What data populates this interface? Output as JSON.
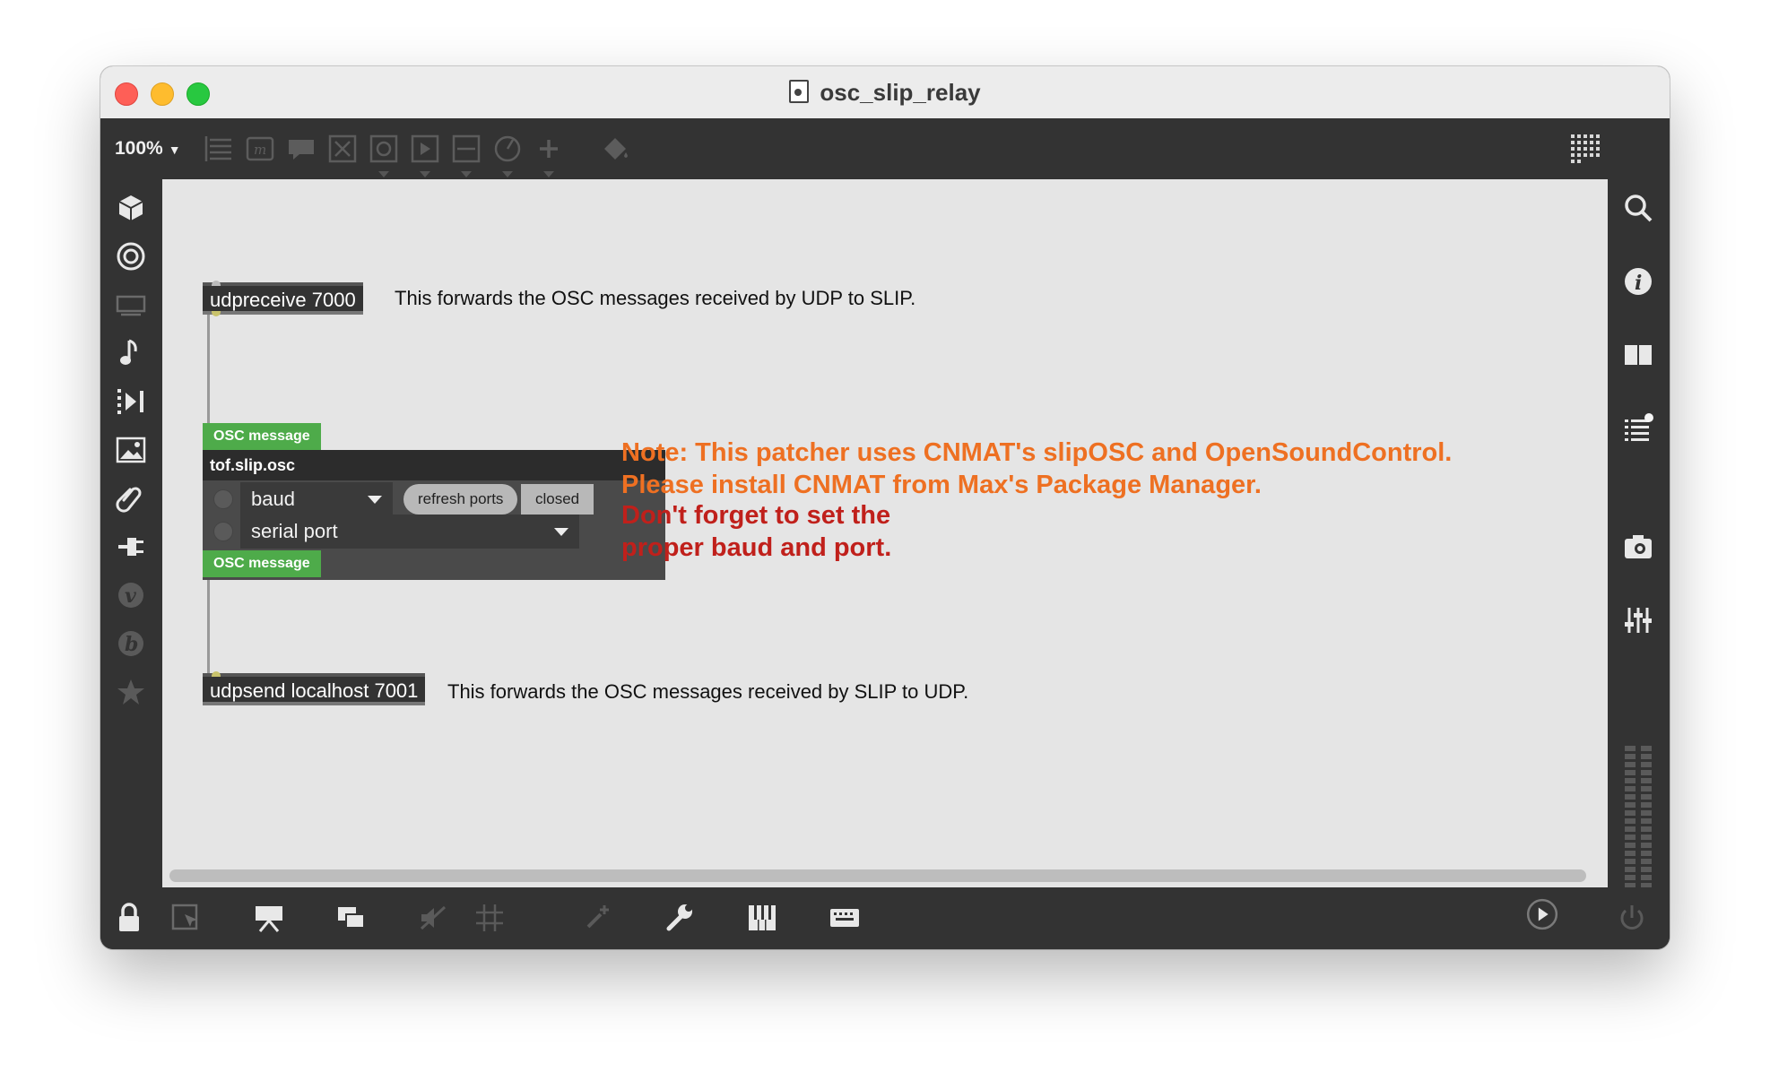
{
  "window": {
    "title": "osc_slip_relay"
  },
  "toolbar": {
    "zoom": "100%",
    "icons": [
      "presentation-icon",
      "message-icon",
      "comment-icon",
      "close-box-icon",
      "button-icon",
      "play-icon",
      "slider-icon",
      "dial-icon",
      "plus-icon",
      "paint-bucket-icon",
      "grid-icon"
    ]
  },
  "left_sidebar": {
    "icons": [
      "cube-icon",
      "target-icon",
      "monitor-icon",
      "music-note-icon",
      "media-icon",
      "image-icon",
      "paperclip-icon",
      "plug-icon",
      "v-icon",
      "b-icon",
      "star-icon"
    ]
  },
  "right_sidebar": {
    "icons": [
      "search-icon",
      "info-icon",
      "book-icon",
      "list-icon",
      "camera-icon",
      "mixer-icon"
    ]
  },
  "patch": {
    "udpreceive": {
      "text": "udpreceive 7000"
    },
    "comment_top": {
      "text": "This forwards the OSC messages received by UDP to SLIP."
    },
    "osc_in": {
      "text": "OSC message"
    },
    "bpatcher": {
      "title": "tof.slip.osc",
      "baud_menu": "baud",
      "refresh_button": "refresh ports",
      "status_toggle": "closed",
      "port_menu": "serial port"
    },
    "osc_out": {
      "text": "OSC message"
    },
    "note_orange_line1": "Note: This patcher uses CNMAT's slipOSC and OpenSoundControl.",
    "note_orange_line2": "Please install CNMAT from Max's Package Manager.",
    "note_red_line1": "Don't forget to set the",
    "note_red_line2": "proper baud and port.",
    "udpsend": {
      "text": "udpsend localhost 7001"
    },
    "comment_bottom": {
      "text": "This forwards the OSC messages received by SLIP to UDP."
    }
  },
  "colors": {
    "note_orange": "#ee7022",
    "note_red": "#c0201b",
    "osc_tag": "#4eab4a",
    "canvas": "#e5e5e5",
    "chrome": "#333333"
  }
}
